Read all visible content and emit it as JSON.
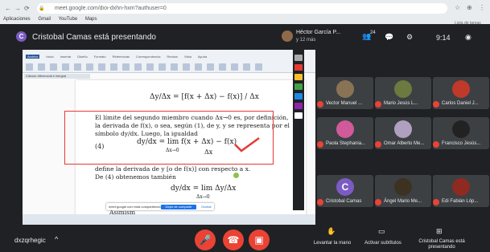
{
  "browser": {
    "url": "meet.google.com/dxx-dxhn-hxm?authuser=0",
    "bookmarks": [
      "Aplicaciones",
      "Gmail",
      "YouTube",
      "Maps"
    ]
  },
  "meet_top": {
    "presenting_label": "Cristobal Camas está presentando",
    "host_name": "Héctor García P...",
    "host_sub": "y 12 más",
    "participants_count": "24",
    "time": "9:14",
    "class_list_label": "Lista de tareas"
  },
  "presentation": {
    "math_top": "Δy/Δx = [f(x + Δx) − f(x)] / Δx",
    "paragraph_lines": [
      "El límite del segundo miembro cuando Δx→0 es, por definición,",
      "la derivada de f(x), o sea, según (1), de y, y se representa por el",
      "símbolo dy/dx. Luego, la igualdad"
    ],
    "eq_label": "(4)",
    "eq_main": "dy/dx = lim   f(x + Δx) − f(x)",
    "eq_limit": "Δx→0",
    "eq_denom": "Δx",
    "after_lines": [
      "define la derivada de y [o de f(x)] con respecto a x.",
      "De (4) obtenemos también"
    ],
    "eq2": "dy/dx = lim  Δy/Δx",
    "eq2_limit": "Δx→0",
    "bottom_word": "Asimism",
    "toast_text": "meet.google.com está compartiendo la pantalla",
    "toast_stop": "Dejar de compartir",
    "toast_hide": "Ocultar"
  },
  "participants": [
    {
      "name": "Vector Manuel ...",
      "color": "#8a7355"
    },
    {
      "name": "Mario Jesús L...",
      "color": "#6b7a3e"
    },
    {
      "name": "Carlos Daniel J...",
      "color": "#c0392b"
    },
    {
      "name": "Paola Stephania...",
      "color": "#d05a9a"
    },
    {
      "name": "Omar Alberto Me...",
      "color": "#b0a0c0"
    },
    {
      "name": "Francisco Jesús...",
      "color": "#222222"
    },
    {
      "name": "Cristobal Camas",
      "color": "#7b5cc4",
      "initial": "C"
    },
    {
      "name": "Ángel Mario Me...",
      "color": "#3d3222"
    },
    {
      "name": "Edi Fabián Lóp...",
      "color": "#8e2a1f"
    }
  ],
  "bottom": {
    "meeting_code": "dxzqrhegic",
    "raise_hand": "Levantar la mano",
    "captions": "Activar subtítulos",
    "presenting": "Cristobal Camas está presentando"
  },
  "colors": {
    "meet_bg": "#202124",
    "red": "#ea4335",
    "accent_purple": "#7b5cc4"
  }
}
